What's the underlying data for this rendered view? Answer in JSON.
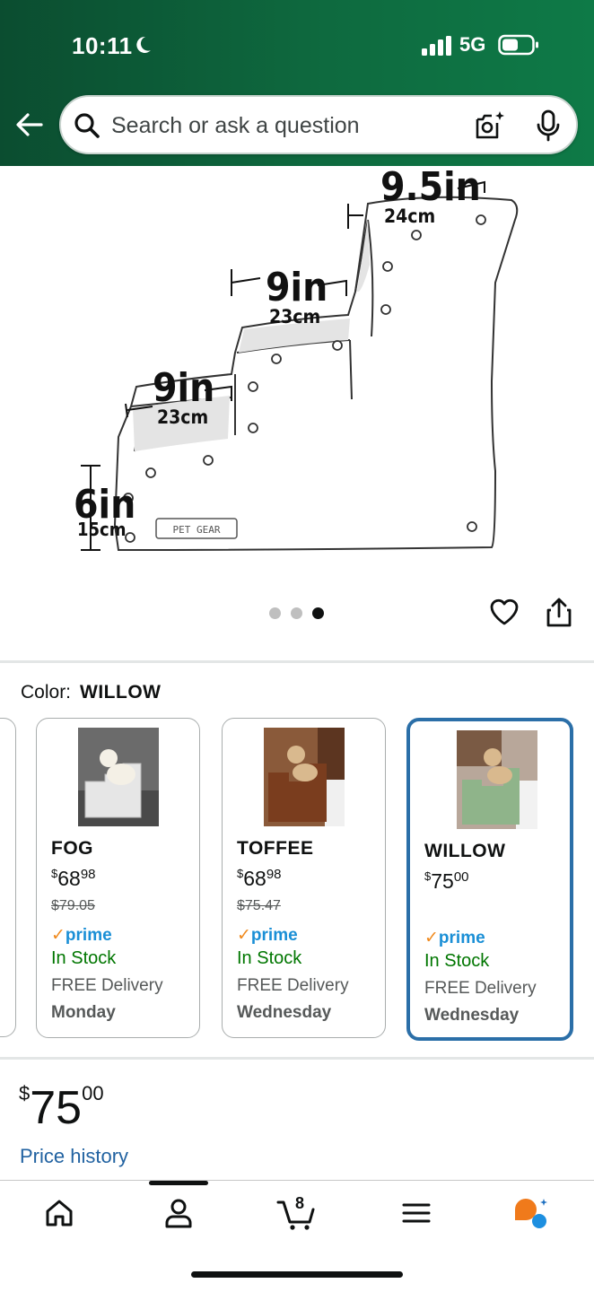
{
  "status_bar": {
    "time": "10:11",
    "network": "5G",
    "icons": [
      "moon-icon",
      "signal-icon",
      "battery-icon"
    ]
  },
  "search": {
    "placeholder": "Search or ask a question",
    "icons": [
      "search-icon",
      "camera-icon",
      "mic-icon"
    ]
  },
  "product_image": {
    "dimension_labels": [
      {
        "main": "9.5in",
        "sub": "24cm"
      },
      {
        "main": "9in",
        "sub": "23cm"
      },
      {
        "main": "9in",
        "sub": "23cm"
      },
      {
        "main": "6in",
        "sub": "15cm"
      }
    ],
    "brand_badge": "PET GEAR",
    "carousel": {
      "count": 3,
      "active_index": 2
    }
  },
  "color_selector": {
    "label": "Color:",
    "selected": "WILLOW",
    "options": [
      {
        "name": "FOG",
        "price_symbol": "$",
        "price_whole": "68",
        "price_cents": "98",
        "was_price": "$79.05",
        "prime": "prime",
        "stock": "In Stock",
        "delivery": "FREE Delivery",
        "day": "Monday",
        "selected": false
      },
      {
        "name": "TOFFEE",
        "price_symbol": "$",
        "price_whole": "68",
        "price_cents": "98",
        "was_price": "$75.47",
        "prime": "prime",
        "stock": "In Stock",
        "delivery": "FREE Delivery",
        "day": "Wednesday",
        "selected": false
      },
      {
        "name": "WILLOW",
        "price_symbol": "$",
        "price_whole": "75",
        "price_cents": "00",
        "was_price": "",
        "prime": "prime",
        "stock": "In Stock",
        "delivery": "FREE Delivery",
        "day": "Wednesday",
        "selected": true
      }
    ]
  },
  "price": {
    "symbol": "$",
    "whole": "75",
    "cents": "00",
    "history_link": "Price history"
  },
  "bottom_nav": {
    "items": [
      "home-icon",
      "account-icon",
      "cart-icon",
      "menu-icon",
      "rufus-icon"
    ],
    "cart_count": "8",
    "active_index": 1
  },
  "colors": {
    "header_green": "#0e6a3f",
    "selected_border": "#2b6fa8",
    "prime_blue": "#1a8fd6",
    "in_stock_green": "#007600",
    "link_blue": "#2162a1"
  }
}
